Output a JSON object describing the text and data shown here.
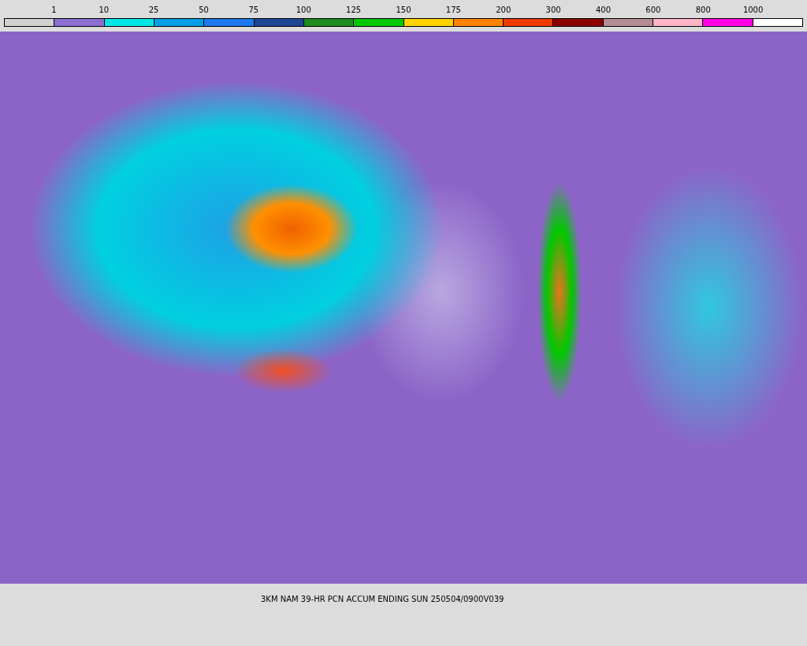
{
  "legend": {
    "labels": [
      "1",
      "10",
      "25",
      "50",
      "75",
      "100",
      "125",
      "150",
      "175",
      "200",
      "300",
      "400",
      "600",
      "800",
      "1000"
    ],
    "segments": [
      {
        "color": "#d2d2d2"
      },
      {
        "color": "#8c6ed2"
      },
      {
        "color": "#00e6e6"
      },
      {
        "color": "#00a0e6"
      },
      {
        "color": "#1e78f0"
      },
      {
        "color": "#1e4696"
      },
      {
        "color": "#1e8c1e"
      },
      {
        "color": "#00c800"
      },
      {
        "color": "#ffd200"
      },
      {
        "color": "#ff8200"
      },
      {
        "color": "#f03c00"
      },
      {
        "color": "#8c0000"
      },
      {
        "color": "#b48c96"
      },
      {
        "color": "#ffb4c8"
      },
      {
        "color": "#ff00e6"
      },
      {
        "color": "#ffffff"
      }
    ]
  },
  "caption": "3KM NAM 39-HR PCN ACCUM ENDING SUN 250504/0900V039"
}
